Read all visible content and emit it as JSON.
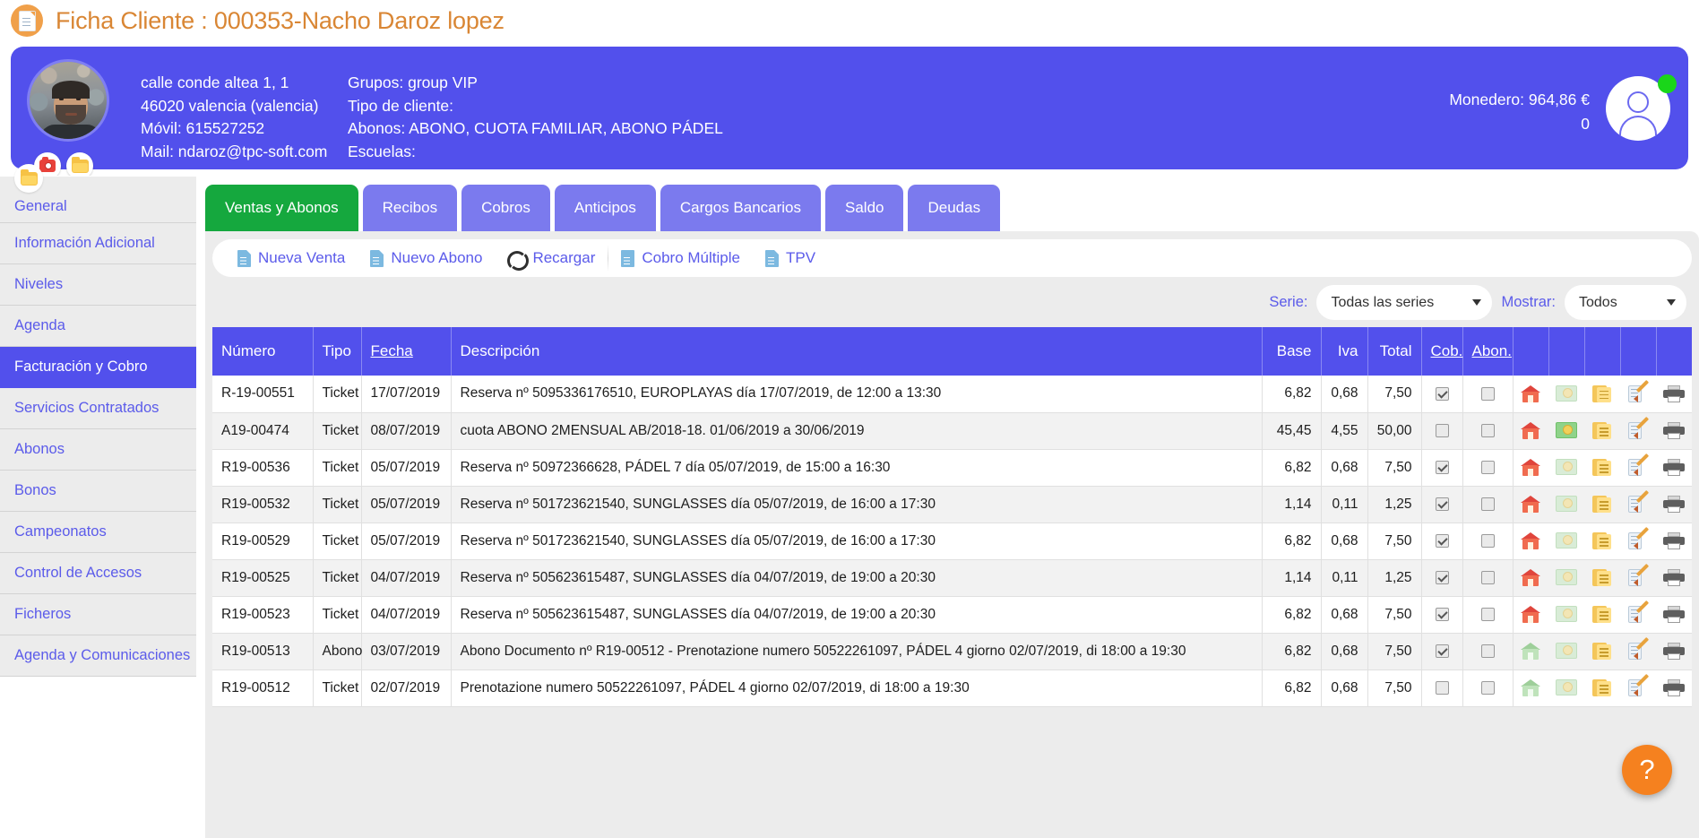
{
  "page": {
    "title": "Ficha Cliente : 000353-Nacho Daroz lopez",
    "doc_icon": "document-icon"
  },
  "client": {
    "address_line1": "calle conde altea 1, 1",
    "address_line2": "46020 valencia (valencia)",
    "mobile": "Móvil: 615527252",
    "mail": "Mail: ndaroz@tpc-soft.com",
    "grupos": "Grupos: group VIP",
    "tipo_cliente": "Tipo de cliente:",
    "abonos": "Abonos: ABONO, CUOTA FAMILIAR, ABONO PÁDEL",
    "escuelas": "Escuelas:",
    "monedero": "Monedero: 964,86 €",
    "monedero_second": "0",
    "camera_icon": "camera-icon",
    "folder_icon": "folder-icon",
    "avatar_icon": "avatar",
    "status_icon": "status-online-dot",
    "accent_color": "#5250ec"
  },
  "sidebar": {
    "folder_icon": "folder-icon",
    "items": [
      {
        "label": "General",
        "active": false
      },
      {
        "label": "Información Adicional",
        "active": false
      },
      {
        "label": "Niveles",
        "active": false
      },
      {
        "label": "Agenda",
        "active": false
      },
      {
        "label": "Facturación y Cobro",
        "active": true
      },
      {
        "label": "Servicios Contratados",
        "active": false
      },
      {
        "label": "Abonos",
        "active": false
      },
      {
        "label": "Bonos",
        "active": false
      },
      {
        "label": "Campeonatos",
        "active": false
      },
      {
        "label": "Control de Accesos",
        "active": false
      },
      {
        "label": "Ficheros",
        "active": false
      },
      {
        "label": "Agenda y Comunicaciones",
        "active": false
      }
    ]
  },
  "tabs": [
    {
      "label": "Ventas y Abonos",
      "active": true
    },
    {
      "label": "Recibos",
      "active": false
    },
    {
      "label": "Cobros",
      "active": false
    },
    {
      "label": "Anticipos",
      "active": false
    },
    {
      "label": "Cargos Bancarios",
      "active": false
    },
    {
      "label": "Saldo",
      "active": false
    },
    {
      "label": "Deudas",
      "active": false
    }
  ],
  "toolbar": [
    {
      "label": "Nueva Venta",
      "icon": "document-icon"
    },
    {
      "label": "Nuevo Abono",
      "icon": "document-icon"
    },
    {
      "label": "Recargar",
      "icon": "refresh-icon"
    },
    {
      "label": "Cobro Múltiple",
      "icon": "document-lines-icon"
    },
    {
      "label": "TPV",
      "icon": "document-icon"
    }
  ],
  "filters": {
    "serie_label": "Serie:",
    "serie_value": "Todas las series",
    "mostrar_label": "Mostrar:",
    "mostrar_value": "Todos"
  },
  "table": {
    "columns": [
      "Número",
      "Tipo",
      "Fecha",
      "Descripción",
      "Base",
      "Iva",
      "Total",
      "Cob.",
      "Abon.",
      "",
      "",
      "",
      "",
      ""
    ],
    "rows": [
      {
        "numero": "R-19-00551",
        "tipo": "Ticket",
        "fecha": "17/07/2019",
        "descripcion": "Reserva nº 5095336176510, EUROPLAYAS día 17/07/2019, de 12:00 a 13:30",
        "base": "6,82",
        "iva": "0,68",
        "total": "7,50",
        "cob": true,
        "abon": false,
        "house_active": true,
        "money_active": false
      },
      {
        "numero": "A19-00474",
        "tipo": "Ticket",
        "fecha": "08/07/2019",
        "descripcion": "cuota ABONO 2MENSUAL AB/2018-18. 01/06/2019 a 30/06/2019",
        "base": "45,45",
        "iva": "4,55",
        "total": "50,00",
        "cob": false,
        "abon": false,
        "house_active": true,
        "money_active": true
      },
      {
        "numero": "R19-00536",
        "tipo": "Ticket",
        "fecha": "05/07/2019",
        "descripcion": "Reserva nº 50972366628, PÁDEL 7 día 05/07/2019, de 15:00 a 16:30",
        "base": "6,82",
        "iva": "0,68",
        "total": "7,50",
        "cob": true,
        "abon": false,
        "house_active": true,
        "money_active": false
      },
      {
        "numero": "R19-00532",
        "tipo": "Ticket",
        "fecha": "05/07/2019",
        "descripcion": "Reserva nº 501723621540, SUNGLASSES día 05/07/2019, de 16:00 a 17:30",
        "base": "1,14",
        "iva": "0,11",
        "total": "1,25",
        "cob": true,
        "abon": false,
        "house_active": true,
        "money_active": false
      },
      {
        "numero": "R19-00529",
        "tipo": "Ticket",
        "fecha": "05/07/2019",
        "descripcion": "Reserva nº 501723621540, SUNGLASSES día 05/07/2019, de 16:00 a 17:30",
        "base": "6,82",
        "iva": "0,68",
        "total": "7,50",
        "cob": true,
        "abon": false,
        "house_active": true,
        "money_active": false
      },
      {
        "numero": "R19-00525",
        "tipo": "Ticket",
        "fecha": "04/07/2019",
        "descripcion": "Reserva nº 505623615487, SUNGLASSES día 04/07/2019, de 19:00 a 20:30",
        "base": "1,14",
        "iva": "0,11",
        "total": "1,25",
        "cob": true,
        "abon": false,
        "house_active": true,
        "money_active": false
      },
      {
        "numero": "R19-00523",
        "tipo": "Ticket",
        "fecha": "04/07/2019",
        "descripcion": "Reserva nº 505623615487, SUNGLASSES día 04/07/2019, de 19:00 a 20:30",
        "base": "6,82",
        "iva": "0,68",
        "total": "7,50",
        "cob": true,
        "abon": false,
        "house_active": true,
        "money_active": false
      },
      {
        "numero": "R19-00513",
        "tipo": "Abono",
        "fecha": "03/07/2019",
        "descripcion": "Abono Documento nº R19-00512 - Prenotazione numero 50522261097, PÁDEL 4 giorno 02/07/2019, di 18:00 a 19:30",
        "base": "6,82",
        "iva": "0,68",
        "total": "7,50",
        "cob": true,
        "abon": false,
        "house_active": false,
        "money_active": false
      },
      {
        "numero": "R19-00512",
        "tipo": "Ticket",
        "fecha": "02/07/2019",
        "descripcion": "Prenotazione numero 50522261097, PÁDEL 4 giorno 02/07/2019, di 18:00 a 19:30",
        "base": "6,82",
        "iva": "0,68",
        "total": "7,50",
        "cob": false,
        "abon": false,
        "house_active": false,
        "money_active": false
      }
    ],
    "row_icons": [
      "house-icon",
      "money-icon",
      "note-icon",
      "edit-icon",
      "print-icon"
    ]
  },
  "help": {
    "label": "?"
  }
}
